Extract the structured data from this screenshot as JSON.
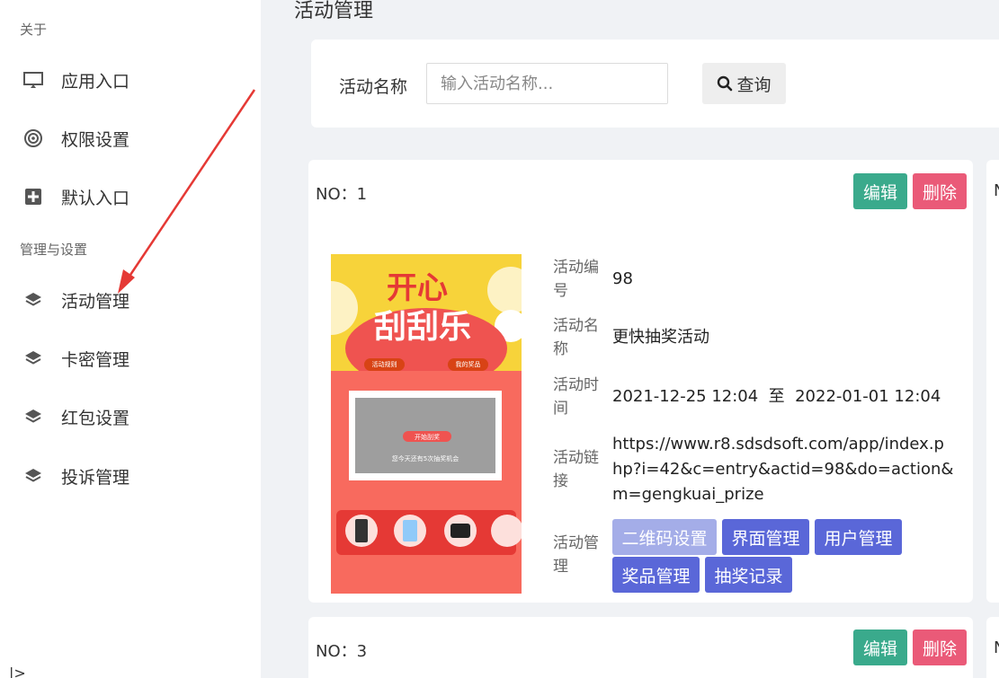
{
  "sidebar": {
    "section_about": "关于",
    "section_manage": "管理与设置",
    "items": [
      {
        "label": "应用入口",
        "icon": "monitor-icon"
      },
      {
        "label": "权限设置",
        "icon": "target-icon"
      },
      {
        "label": "默认入口",
        "icon": "plus-square-icon"
      },
      {
        "label": "活动管理",
        "icon": "layers-icon"
      },
      {
        "label": "卡密管理",
        "icon": "layers-icon"
      },
      {
        "label": "红包设置",
        "icon": "layers-icon"
      },
      {
        "label": "投诉管理",
        "icon": "layers-icon"
      }
    ],
    "collapse_glyph": "|>"
  },
  "page": {
    "title": "活动管理"
  },
  "search": {
    "label": "活动名称",
    "placeholder": "输入活动名称...",
    "button": "查询"
  },
  "cards": [
    {
      "no": "NO：1",
      "edit": "编辑",
      "delete": "删除",
      "poster": {
        "title_line1": "开心",
        "title_line2": "刮刮乐",
        "rules_btn": "活动规则",
        "my_prize_btn": "我的奖品",
        "start_btn": "开始刮奖",
        "chances_text": "您今天还有5次抽奖机会"
      },
      "labels": {
        "id": "活动编号",
        "name": "活动名称",
        "time": "活动时间",
        "link": "活动链接",
        "manage": "活动管理"
      },
      "id": "98",
      "name": "更快抽奖活动",
      "time": "2021-12-25 12:04  至  2022-01-01 12:04",
      "link": "https://www.r8.sdsdsoft.com/app/index.php?i=42&c=entry&actid=98&do=action&m=gengkuai_prize",
      "manage_buttons": [
        "二维码设置",
        "界面管理",
        "用户管理",
        "奖品管理",
        "抽奖记录"
      ]
    },
    {
      "no": "NO：3",
      "edit": "编辑",
      "delete": "删除"
    }
  ],
  "partial_letter": "N",
  "colors": {
    "edit": "#3aaa8c",
    "delete": "#ea5a78",
    "manage_primary": "#5a67d8",
    "manage_light": "#a4ade8",
    "arrow": "#e53935"
  }
}
